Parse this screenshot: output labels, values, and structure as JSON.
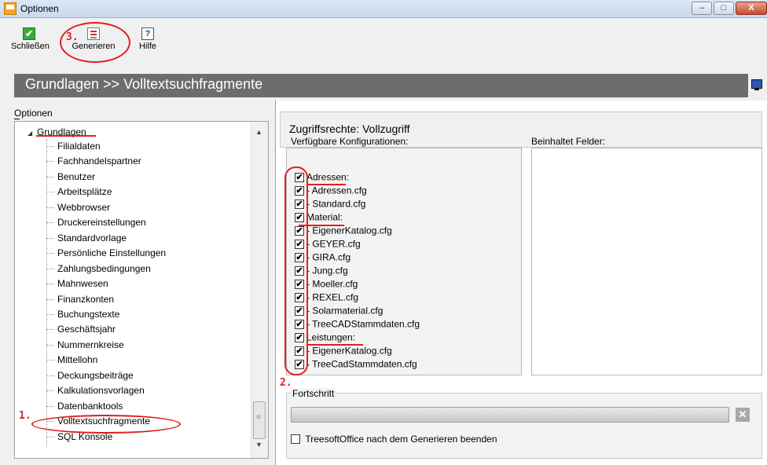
{
  "window": {
    "title": "Optionen",
    "controls": {
      "minimize": "–",
      "maximize": "□",
      "close": "X"
    }
  },
  "toolbar": {
    "close_label": "Schließen",
    "generate_label": "Generieren",
    "help_label": "Hilfe",
    "close_icon": "✔",
    "help_icon": "?"
  },
  "header": {
    "title": "Grundlagen >> Volltextsuchfragmente"
  },
  "left": {
    "options_label": "Optionen",
    "tree_root": "Grundlagen",
    "tree_items": [
      "Filialdaten",
      "Fachhandelspartner",
      "Benutzer",
      "Arbeitsplätze",
      "Webbrowser",
      "Druckereinstellungen",
      "Standardvorlage",
      "Persönliche Einstellungen",
      "Zahlungsbedingungen",
      "Mahnwesen",
      "Finanzkonten",
      "Buchungstexte",
      "Geschäftsjahr",
      "Nummernkreise",
      "Mittellohn",
      "Deckungsbeiträge",
      "Kalkulationsvorlagen",
      "Datenbanktools",
      "Volltextsuchfragmente",
      "SQL Konsole"
    ]
  },
  "right": {
    "access_rights": "Zugriffsrechte: Vollzugriff",
    "available_label": "Verfügbare Konfigurationen:",
    "fields_label": "Beinhaltet Felder:",
    "configurations": [
      {
        "label": "Adressen:",
        "checked": true
      },
      {
        "label": "- Adressen.cfg",
        "checked": true
      },
      {
        "label": "- Standard.cfg",
        "checked": true
      },
      {
        "label": "Material:",
        "checked": true
      },
      {
        "label": "- EigenerKatalog.cfg",
        "checked": true
      },
      {
        "label": "- GEYER.cfg",
        "checked": true
      },
      {
        "label": "- GIRA.cfg",
        "checked": true
      },
      {
        "label": "- Jung.cfg",
        "checked": true
      },
      {
        "label": "- Moeller.cfg",
        "checked": true
      },
      {
        "label": "- REXEL.cfg",
        "checked": true
      },
      {
        "label": "- Solarmaterial.cfg",
        "checked": true
      },
      {
        "label": "- TreeCADStammdaten.cfg",
        "checked": true
      },
      {
        "label": "Leistungen:",
        "checked": true
      },
      {
        "label": "- EigenerKatalog.cfg",
        "checked": true
      },
      {
        "label": "- TreeCadStammdaten.cfg",
        "checked": true
      }
    ],
    "progress_label": "Fortschritt",
    "progress_value": 0,
    "cancel_icon": "✕",
    "quit_after_label": "TreesoftOffice nach dem Generieren beenden",
    "quit_after_checked": false
  },
  "annotations": {
    "step1": "1.",
    "step2": "2.",
    "step3": "3.",
    "color": "#e02020"
  }
}
